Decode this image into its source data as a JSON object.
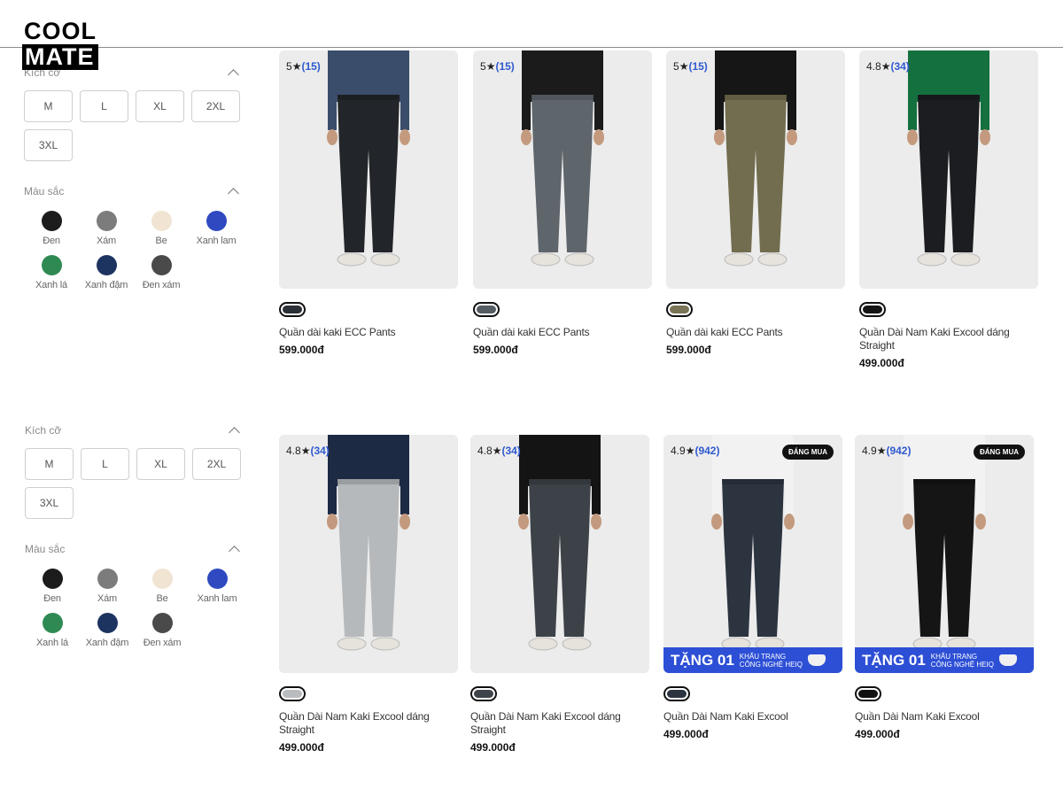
{
  "logo": {
    "line1": "COOL",
    "line2": "MATE"
  },
  "filters": {
    "size_title": "Kích cỡ",
    "sizes": [
      "M",
      "L",
      "XL",
      "2XL",
      "3XL"
    ],
    "color_title": "Màu sắc",
    "colors": [
      {
        "label": "Đen",
        "hex": "#1c1c1c"
      },
      {
        "label": "Xám",
        "hex": "#7c7c7c"
      },
      {
        "label": "Be",
        "hex": "#f1e4d3"
      },
      {
        "label": "Xanh lam",
        "hex": "#2f49c0"
      },
      {
        "label": "Xanh lá",
        "hex": "#2e8a52"
      },
      {
        "label": "Xanh đậm",
        "hex": "#1d3461"
      },
      {
        "label": "Đen xám",
        "hex": "#4a4a4a"
      }
    ]
  },
  "products_top": [
    {
      "rating": "5",
      "count": "(15)",
      "name": "Quần dài kaki ECC Pants",
      "price": "599.000đ",
      "chip": "#2b3036",
      "pants": "#222529",
      "top": "#3a4d6b"
    },
    {
      "rating": "5",
      "count": "(15)",
      "name": "Quần dài kaki ECC Pants",
      "price": "599.000đ",
      "chip": "#555d63",
      "pants": "#5e656b",
      "top": "#1b1b1b"
    },
    {
      "rating": "5",
      "count": "(15)",
      "name": "Quần dài kaki ECC Pants",
      "price": "599.000đ",
      "chip": "#7a7355",
      "pants": "#726d4f",
      "top": "#161616"
    },
    {
      "rating": "4.8",
      "count": "(34)",
      "name": "Quần Dài Nam Kaki Excool dáng Straight",
      "price": "499.000đ",
      "chip": "#151515",
      "pants": "#1c1d20",
      "top": "#15703f"
    }
  ],
  "products_bottom": [
    {
      "rating": "4.8",
      "count": "(34)",
      "name": "Quần Dài Nam Kaki Excool dáng Straight",
      "price": "499.000đ",
      "chip": "#b9bcbf",
      "pants": "#b6b9bc",
      "top": "#1d2a44"
    },
    {
      "rating": "4.8",
      "count": "(34)",
      "name": "Quần Dài Nam Kaki Excool dáng Straight",
      "price": "499.000đ",
      "chip": "#3e4449",
      "pants": "#3c4247",
      "top": "#141414"
    },
    {
      "rating": "4.9",
      "count": "(942)",
      "name": "Quần Dài Nam Kaki Excool",
      "price": "499.000đ",
      "chip": "#2b3440",
      "pants": "#2c3440",
      "top": "#f2f2f2",
      "badge": "ĐÁNG MUA",
      "promo_big": "TẶNG 01",
      "promo_small1": "KHẨU TRANG",
      "promo_small2": "CÔNG NGHỆ HEIQ"
    },
    {
      "rating": "4.9",
      "count": "(942)",
      "name": "Quần Dài Nam Kaki Excool",
      "price": "499.000đ",
      "chip": "#111111",
      "pants": "#151515",
      "top": "#f2f2f2",
      "badge": "ĐÁNG MUA",
      "promo_big": "TẶNG 01",
      "promo_small1": "KHẨU TRANG",
      "promo_small2": "CÔNG NGHỆ HEIQ"
    }
  ]
}
